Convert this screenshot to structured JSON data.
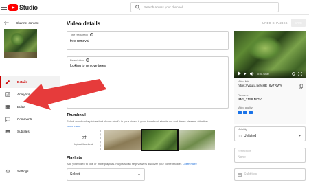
{
  "topbar": {
    "logo_text": "Studio",
    "search_placeholder": "Search across your channel"
  },
  "sidebar": {
    "back_label": "Channel content",
    "video_title": "Video",
    "video_subtitle": "tree removal",
    "items": [
      {
        "label": "Details",
        "icon": "pencil-icon",
        "active": true
      },
      {
        "label": "Analytics",
        "icon": "analytics-icon",
        "active": false
      },
      {
        "label": "Editor",
        "icon": "film-icon",
        "active": false
      },
      {
        "label": "Comments",
        "icon": "comment-icon",
        "active": false
      },
      {
        "label": "Subtitles",
        "icon": "subtitles-icon",
        "active": false
      }
    ],
    "settings_label": "Settings"
  },
  "main": {
    "heading": "Video details",
    "undo_label": "UNDO CHANGES",
    "save_label": "SAVE",
    "title_field": {
      "label": "Title (required)",
      "value": "tree removal"
    },
    "description_field": {
      "label": "Description",
      "value": "looking to remove trees"
    },
    "thumbnail": {
      "title": "Thumbnail",
      "desc": "Select or upload a picture that shows what's in your video. A good thumbnail stands out and draws viewers' attention.",
      "learn_more": "Learn more",
      "upload_label": "Upload thumbnail"
    },
    "playlists": {
      "title": "Playlists",
      "desc": "Add your video to one or more playlists. Playlists can help viewers discover your content faster.",
      "learn_more": "Learn more",
      "select_value": "Select"
    }
  },
  "right": {
    "video_link_label": "Video link",
    "video_link": "https://youtu.be/cHE_6v7RWY",
    "filename_label": "Filename",
    "filename": "IMG_2159.MOV",
    "quality_label": "Video quality",
    "visibility_label": "Visibility",
    "visibility_value": "Unlisted",
    "restrictions_label": "Restrictions",
    "restrictions_value": "None",
    "subtitles_value": "Subtitles",
    "time": "0:00 / 0:30"
  },
  "colors": {
    "brand_red": "#ff0000",
    "active_red": "#cc0000",
    "link_blue": "#065fd4",
    "annotation_arrow": "#e63b3b"
  }
}
